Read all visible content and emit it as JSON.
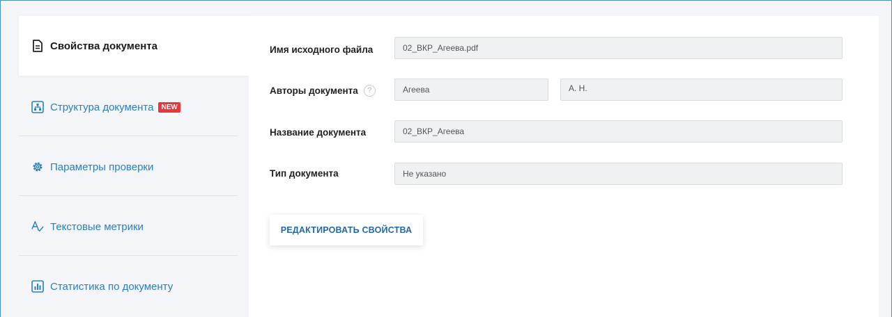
{
  "sidebar": {
    "items": [
      {
        "label": "Свойства документа",
        "icon": "document-icon"
      },
      {
        "label": "Структура документа",
        "icon": "structure-icon",
        "badge": "NEW"
      },
      {
        "label": "Параметры проверки",
        "icon": "gear-icon"
      },
      {
        "label": "Текстовые метрики",
        "icon": "text-metrics-icon"
      },
      {
        "label": "Статистика по документу",
        "icon": "bar-chart-icon"
      }
    ]
  },
  "form": {
    "filename_label": "Имя исходного файла",
    "filename_value": "02_ВКР_Агеева.pdf",
    "authors_label": "Авторы документа",
    "authors_help": "?",
    "author_lastname": "Агеева",
    "author_initials": "А. Н.",
    "title_label": "Название документа",
    "title_value": "02_ВКР_Агеева",
    "type_label": "Тип документа",
    "type_value": "Не указано",
    "edit_button": "РЕДАКТИРОВАТЬ СВОЙСТВА"
  },
  "colors": {
    "accent": "#2b7fc0",
    "badge": "#e8363b",
    "field_bg": "#f0f1f2"
  }
}
